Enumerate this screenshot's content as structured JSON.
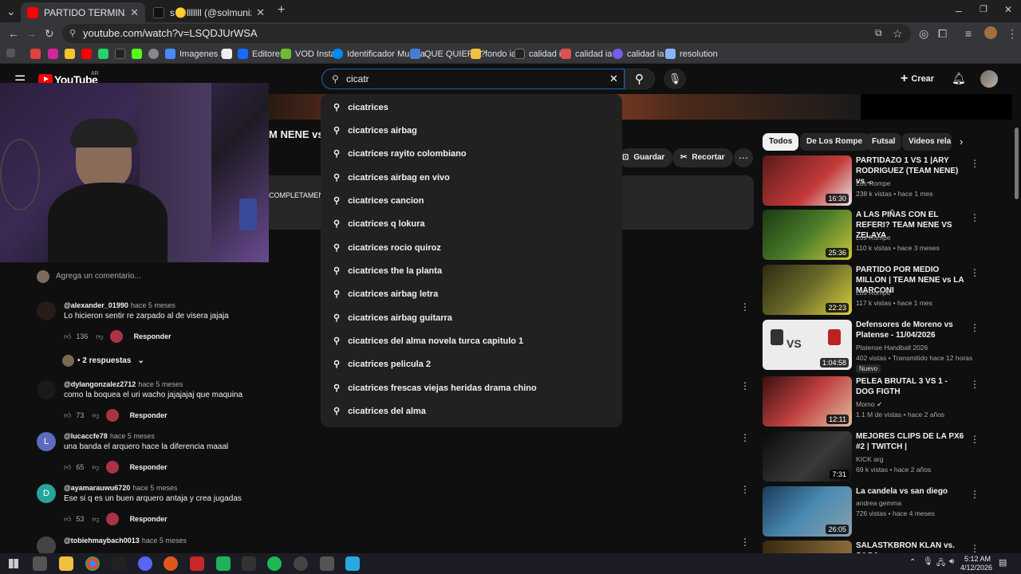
{
  "browser": {
    "tabs": [
      {
        "label": "PARTIDO TERMINA EN BATALLA"
      },
      {
        "label": "s🟡lllllll (@solmunizaga_) | TikTok"
      }
    ],
    "url": "youtube.com/watch?v=LSQDJUrWSA",
    "bookmarks": [
      "Imagenes IA",
      "Editores",
      "VOD Install",
      "Identificador Musica",
      "QUE QUIERO?",
      "fondo ia",
      "calidad ia",
      "calidad ia 2",
      "calidad ia 3",
      "resolution"
    ],
    "colors": {
      "tab_active": "#35363a",
      "accent": "#1c62b9"
    }
  },
  "youtube": {
    "logo": "YouTube",
    "country": "AR",
    "search_value": "cicatr",
    "create_label": "Crear",
    "suggestions": [
      "cicatrices",
      "cicatrices airbag",
      "cicatrices rayito colombiano",
      "cicatrices airbag en vivo",
      "cicatrices cancion",
      "cicatrices q lokura",
      "cicatrices rocio quiroz",
      "cicatrices the la planta",
      "cicatrices airbag letra",
      "cicatrices airbag guitarra",
      "cicatrices del alma novela turca capitulo 1",
      "cicatrices pelicula 2",
      "cicatrices frescas viejas heridas drama chino",
      "cicatrices del alma"
    ],
    "video_title_fragment": "M NENE vs",
    "description_fragment": "COMPLETAMEN",
    "actions": {
      "save": "Guardar",
      "clip": "Recortar"
    },
    "chips": [
      "Todos",
      "De Los Rompe",
      "Futsal",
      "Videos rela"
    ],
    "add_comment_placeholder": "Agrega un comentario...",
    "comments": [
      {
        "user": "@alexander_01990",
        "time": "hace 5 meses",
        "text": "Lo hicieron sentir re zarpado al de visera jajaja",
        "likes": "136",
        "reply": "Responder"
      },
      {
        "user": "@dylangonzalez2712",
        "time": "hace 5 meses",
        "text": "como la boquea el uri wacho jajajajaj que maquina",
        "likes": "73",
        "reply": "Responder"
      },
      {
        "user": "@lucaccfe78",
        "time": "hace 5 meses",
        "text": "una banda el arquero hace la diferencia maaal",
        "likes": "65",
        "reply": "Responder",
        "initial": "L"
      },
      {
        "user": "@ayamarauwu6720",
        "time": "hace 5 meses",
        "text": "Ese si q es un buen arquero antaja y crea jugadas",
        "likes": "53",
        "reply": "Responder",
        "initial": "D"
      },
      {
        "user": "@tobiehmaybach0013",
        "time": "hace 5 meses",
        "text": "",
        "likes": "",
        "reply": ""
      }
    ],
    "replies_label": "2 respuestas",
    "related": [
      {
        "title": "PARTIDAZO 1 VS 1 |ARY RODRIGUEZ (TEAM NENE) vs ...",
        "channel": "Los Rompe",
        "meta": "238 k vistas • hace 1 mes",
        "duration": "16:30",
        "thumb": "#7a2020"
      },
      {
        "title": "A LAS PIÑAS CON EL REFERI? TEAM NENE VS ZELAYA",
        "channel": "Los Rompe",
        "meta": "110 k vistas • hace 3 meses",
        "duration": "25:36",
        "thumb": "#2a4a1a"
      },
      {
        "title": "PARTIDO POR MEDIO MILLON | TEAM NENE vs LA MARCONI",
        "channel": "Los Rompe",
        "meta": "117 k vistas • hace 1 mes",
        "duration": "22:23",
        "thumb": "#3a3a1a"
      },
      {
        "title": "Defensores de Moreno vs Platense - 11/04/2026",
        "channel": "Platense Handball 2026",
        "meta": "402 vistas • Transmitido hace 12 horas",
        "duration": "1:04:58",
        "thumb": "#e8e8e8",
        "badge": "Nuevo"
      },
      {
        "title": "PELEA BRUTAL 3 VS 1 - DOG FIGTH",
        "channel": "Momo",
        "meta": "1.1 M de vistas • hace 2 años",
        "duration": "12:11",
        "thumb": "#8a2a2a"
      },
      {
        "title": "MEJORES CLIPS DE LA PX6 #2 | TWITCH |",
        "channel": "KICK arg",
        "meta": "69 k vistas • hace 2 años",
        "duration": "7:31",
        "thumb": "#1a1a1a"
      },
      {
        "title": "La candela vs san diego",
        "channel": "andrea gemma",
        "meta": "726 vistas • hace 4 meses",
        "duration": "26:05",
        "thumb": "#2a5a7a"
      },
      {
        "title": "SALASTKBRON KLAN vs. SAGA",
        "channel": "",
        "meta": "",
        "duration": "",
        "thumb": "#5a4a2a"
      }
    ]
  },
  "taskbar": {
    "time": "5:12 AM",
    "date": "4/12/2026"
  }
}
